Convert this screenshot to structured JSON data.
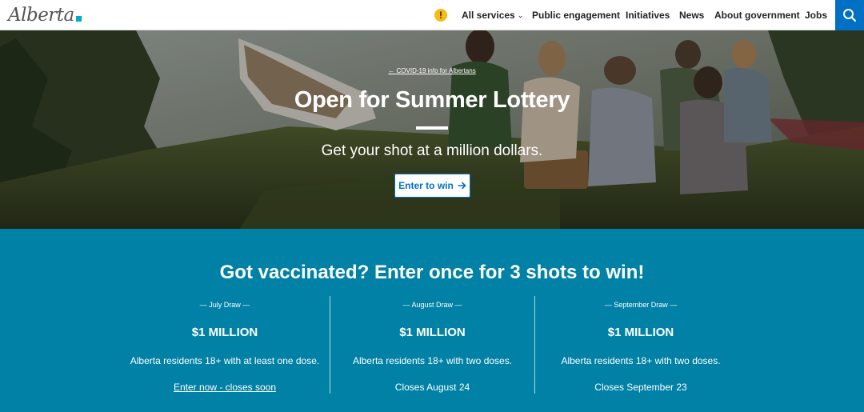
{
  "header": {
    "logo_text": "Alberta",
    "alert_symbol": "!",
    "nav": {
      "all_services": "All services",
      "public_engagement": "Public engagement",
      "initiatives": "Initiatives",
      "news": "News",
      "about_government": "About government",
      "jobs": "Jobs"
    },
    "icons": {
      "alert": "alert-icon",
      "search": "search-icon",
      "chevron": "chevron-down-icon"
    }
  },
  "hero": {
    "covid_link": "COVID-19 info for Albertans",
    "title": "Open for Summer Lottery",
    "subtitle": "Get your shot at a million dollars.",
    "cta": "Enter to win"
  },
  "draws": {
    "title": "Got vaccinated? Enter once for 3 shots to win!",
    "items": [
      {
        "name": "— July Draw —",
        "amount": "$1 MILLION",
        "description": "Alberta residents 18+ with at least one dose.",
        "closing": "Enter now - closes soon"
      },
      {
        "name": "— August Draw —",
        "amount": "$1 MILLION",
        "description": "Alberta residents 18+ with two doses.",
        "closing": "Closes August 24"
      },
      {
        "name": "— September Draw —",
        "amount": "$1 MILLION",
        "description": "Alberta residents 18+ with two doses.",
        "closing": "Closes September 23"
      }
    ]
  },
  "colors": {
    "brand_blue": "#0070c4",
    "section_teal": "#0081a5",
    "alert_yellow": "#f9bb12",
    "logo_accent": "#00aad2"
  }
}
